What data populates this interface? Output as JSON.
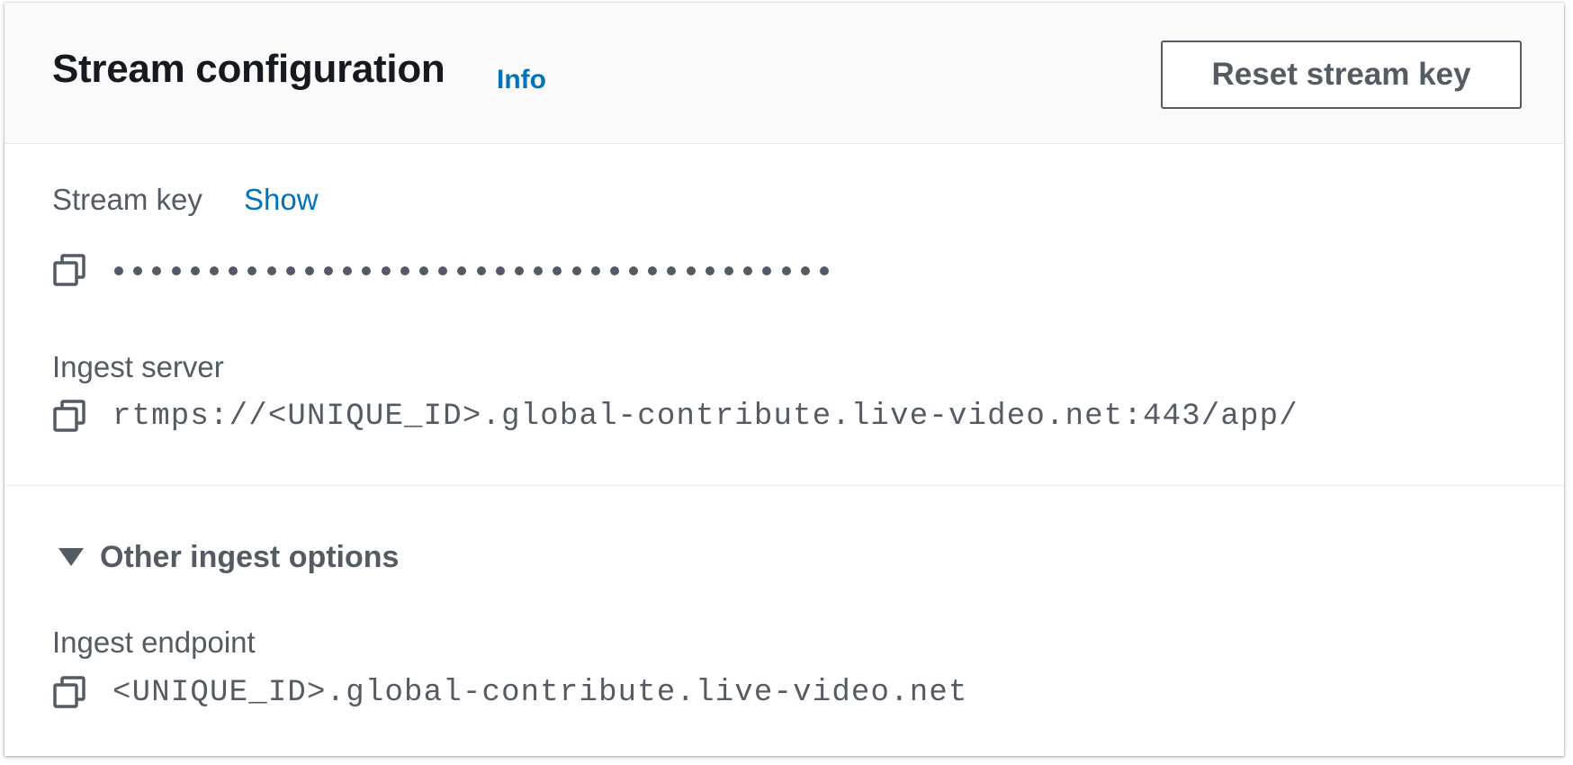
{
  "panel": {
    "title": "Stream configuration",
    "info_label": "Info",
    "reset_button_label": "Reset stream key"
  },
  "stream_key": {
    "label": "Stream key",
    "show_label": "Show",
    "masked_char_count": 38,
    "copy_icon": "copy-icon"
  },
  "ingest_server": {
    "label": "Ingest server",
    "value": "rtmps://<UNIQUE_ID>.global-contribute.live-video.net:443/app/",
    "copy_icon": "copy-icon"
  },
  "other_ingest": {
    "expander_label": "Other ingest options",
    "expanded": true,
    "endpoint_label": "Ingest endpoint",
    "endpoint_value": "<UNIQUE_ID>.global-contribute.live-video.net",
    "copy_icon": "copy-icon"
  },
  "colors": {
    "link": "#0073bb",
    "text_secondary": "#545b64",
    "title": "#16191f",
    "header_bg": "#fafafa"
  }
}
